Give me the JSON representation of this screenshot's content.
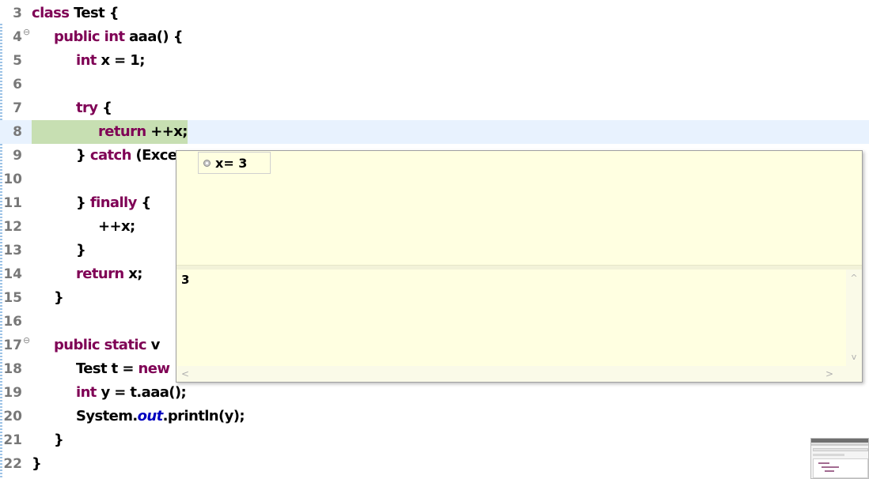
{
  "editor": {
    "lines": [
      {
        "num": "3",
        "tokens": [
          {
            "t": "class",
            "k": "kw"
          },
          {
            "t": " Test {"
          }
        ],
        "indent": 0,
        "fold": false
      },
      {
        "num": "4",
        "tokens": [
          {
            "t": "public",
            "k": "kw"
          },
          {
            "t": " "
          },
          {
            "t": "int",
            "k": "kw"
          },
          {
            "t": " aaa() {"
          }
        ],
        "indent": 1,
        "fold": true
      },
      {
        "num": "5",
        "tokens": [
          {
            "t": "int",
            "k": "kw"
          },
          {
            "t": " x = 1;"
          }
        ],
        "indent": 2,
        "fold": false
      },
      {
        "num": "6",
        "tokens": [],
        "indent": 0,
        "fold": false
      },
      {
        "num": "7",
        "tokens": [
          {
            "t": "try",
            "k": "kw"
          },
          {
            "t": " {"
          }
        ],
        "indent": 2,
        "fold": false
      },
      {
        "num": "8",
        "tokens": [
          {
            "t": "return",
            "k": "kw"
          },
          {
            "t": " ++x;"
          }
        ],
        "indent": 3,
        "fold": false,
        "current": true
      },
      {
        "num": "9",
        "tokens": [
          {
            "t": "} "
          },
          {
            "t": "catch",
            "k": "kw"
          },
          {
            "t": " (Exce"
          }
        ],
        "indent": 2,
        "fold": false
      },
      {
        "num": "10",
        "tokens": [],
        "indent": 0,
        "fold": false
      },
      {
        "num": "11",
        "tokens": [
          {
            "t": "} "
          },
          {
            "t": "finally",
            "k": "kw"
          },
          {
            "t": " {"
          }
        ],
        "indent": 2,
        "fold": false
      },
      {
        "num": "12",
        "tokens": [
          {
            "t": "++x;"
          }
        ],
        "indent": 3,
        "fold": false
      },
      {
        "num": "13",
        "tokens": [
          {
            "t": "}"
          }
        ],
        "indent": 2,
        "fold": false
      },
      {
        "num": "14",
        "tokens": [
          {
            "t": "return",
            "k": "kw"
          },
          {
            "t": " x;"
          }
        ],
        "indent": 2,
        "fold": false
      },
      {
        "num": "15",
        "tokens": [
          {
            "t": "}"
          }
        ],
        "indent": 1,
        "fold": false
      },
      {
        "num": "16",
        "tokens": [],
        "indent": 0,
        "fold": false
      },
      {
        "num": "17",
        "tokens": [
          {
            "t": "public",
            "k": "kw"
          },
          {
            "t": " "
          },
          {
            "t": "static",
            "k": "kw"
          },
          {
            "t": " v"
          }
        ],
        "indent": 1,
        "fold": true
      },
      {
        "num": "18",
        "tokens": [
          {
            "t": "Test t = "
          },
          {
            "t": "new",
            "k": "kw"
          }
        ],
        "indent": 2,
        "fold": false
      },
      {
        "num": "19",
        "tokens": [
          {
            "t": "int",
            "k": "kw"
          },
          {
            "t": " y = t.aaa();"
          }
        ],
        "indent": 2,
        "fold": false
      },
      {
        "num": "20",
        "tokens": [
          {
            "t": "System."
          },
          {
            "t": "out",
            "k": "field"
          },
          {
            "t": ".println(y);"
          }
        ],
        "indent": 2,
        "fold": false
      },
      {
        "num": "21",
        "tokens": [
          {
            "t": "}"
          }
        ],
        "indent": 1,
        "fold": false
      },
      {
        "num": "22",
        "tokens": [
          {
            "t": "}"
          }
        ],
        "indent": 0,
        "fold": false
      }
    ]
  },
  "popup": {
    "variable_label": "x= 3",
    "variable_icon": "local-variable-icon",
    "detail_value": "3",
    "scroll_up": "^",
    "scroll_down": "v",
    "scroll_left": "<",
    "scroll_right": ">"
  }
}
